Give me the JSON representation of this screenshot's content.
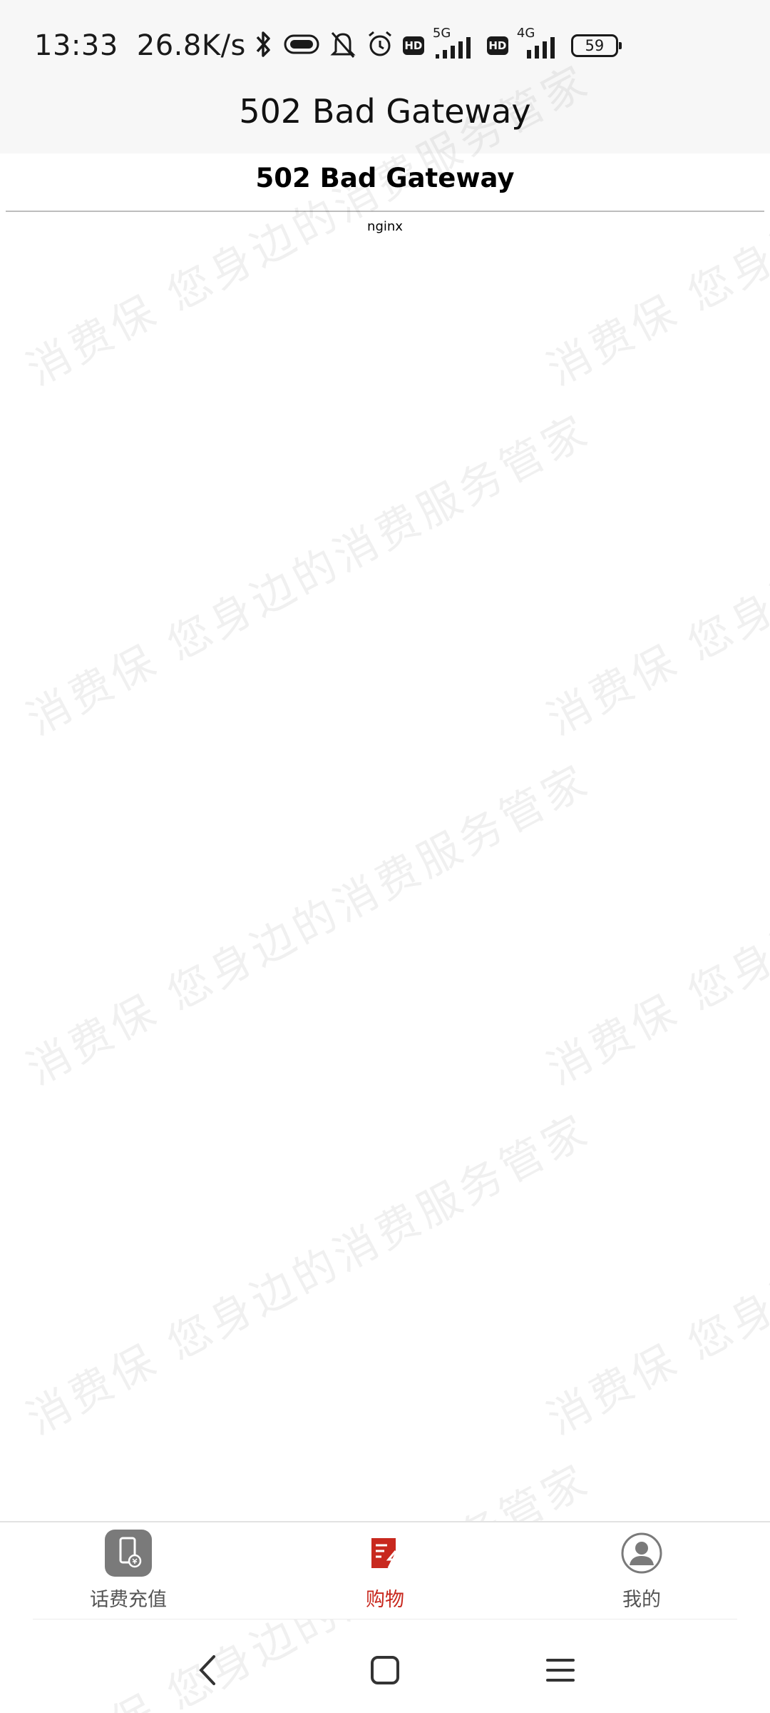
{
  "status_bar": {
    "time": "13:33",
    "net_speed": "26.8K/s",
    "signal1_label": "5G",
    "signal2_label": "4G",
    "hd_label": "HD",
    "battery_level": "59"
  },
  "header": {
    "title": "502 Bad Gateway"
  },
  "page": {
    "heading": "502 Bad Gateway",
    "server": "nginx"
  },
  "watermark": {
    "text": "消费保 您身边的消费服务管家"
  },
  "tabbar": {
    "items": [
      {
        "label": "话费充值",
        "icon": "phone-recharge-icon",
        "active": false
      },
      {
        "label": "购物",
        "icon": "shopping-icon",
        "active": true
      },
      {
        "label": "我的",
        "icon": "profile-icon",
        "active": false
      }
    ]
  },
  "colors": {
    "accent": "#c8281e",
    "header_bg": "#f7f7f7"
  }
}
